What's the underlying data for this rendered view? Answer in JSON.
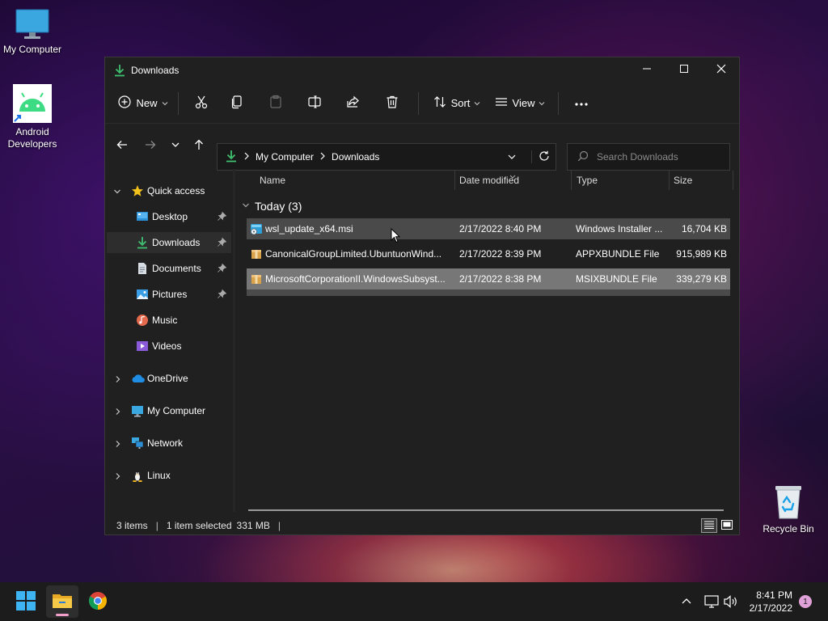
{
  "desktop": {
    "icons": [
      {
        "label": "My Computer",
        "icon": "monitor-icon"
      },
      {
        "label": "Android Developers",
        "icon": "android-icon"
      },
      {
        "label": "Recycle Bin",
        "icon": "recycle-bin-icon"
      }
    ]
  },
  "window": {
    "title": "Downloads",
    "controls": {
      "minimize": "minimize",
      "maximize": "maximize",
      "close": "close"
    },
    "toolbar": {
      "new_label": "New",
      "sort_label": "Sort",
      "view_label": "View",
      "icons": [
        "cut-icon",
        "copy-icon",
        "paste-icon",
        "rename-icon",
        "share-icon",
        "delete-icon",
        "more-icon"
      ]
    },
    "address": {
      "segments": [
        "My Computer",
        "Downloads"
      ],
      "search_placeholder": "Search Downloads"
    },
    "sidebar": {
      "quick_access": "Quick access",
      "items": [
        {
          "label": "Desktop",
          "icon": "desktop-folder-icon",
          "pinned": true
        },
        {
          "label": "Downloads",
          "icon": "downloads-folder-icon",
          "pinned": true,
          "selected": true
        },
        {
          "label": "Documents",
          "icon": "documents-folder-icon",
          "pinned": true
        },
        {
          "label": "Pictures",
          "icon": "pictures-folder-icon",
          "pinned": true
        },
        {
          "label": "Music",
          "icon": "music-folder-icon",
          "pinned": false
        },
        {
          "label": "Videos",
          "icon": "videos-folder-icon",
          "pinned": false
        }
      ],
      "roots": [
        {
          "label": "OneDrive",
          "icon": "onedrive-icon"
        },
        {
          "label": "My Computer",
          "icon": "computer-icon"
        },
        {
          "label": "Network",
          "icon": "network-icon"
        },
        {
          "label": "Linux",
          "icon": "linux-icon"
        }
      ]
    },
    "columns": {
      "name": "Name",
      "date": "Date modified",
      "type": "Type",
      "size": "Size"
    },
    "group": "Today (3)",
    "files": [
      {
        "name": "wsl_update_x64.msi",
        "date": "2/17/2022 8:40 PM",
        "type": "Windows Installer ...",
        "size": "16,704 KB",
        "state": "hover"
      },
      {
        "name": "CanonicalGroupLimited.UbuntuonWind...",
        "date": "2/17/2022 8:39 PM",
        "type": "APPXBUNDLE File",
        "size": "915,989 KB",
        "state": "none"
      },
      {
        "name": "MicrosoftCorporationII.WindowsSubsyst...",
        "date": "2/17/2022 8:38 PM",
        "type": "MSIXBUNDLE File",
        "size": "339,279 KB",
        "state": "selected"
      }
    ],
    "status": {
      "items": "3 items",
      "selected": "1 item selected",
      "size": "331 MB"
    }
  },
  "taskbar": {
    "time": "8:41 PM",
    "date": "2/17/2022",
    "notification_count": "1",
    "apps": [
      "start-icon",
      "file-explorer-icon",
      "chrome-icon"
    ],
    "tray": [
      "chevron-up-icon",
      "network-icon",
      "volume-icon"
    ]
  }
}
